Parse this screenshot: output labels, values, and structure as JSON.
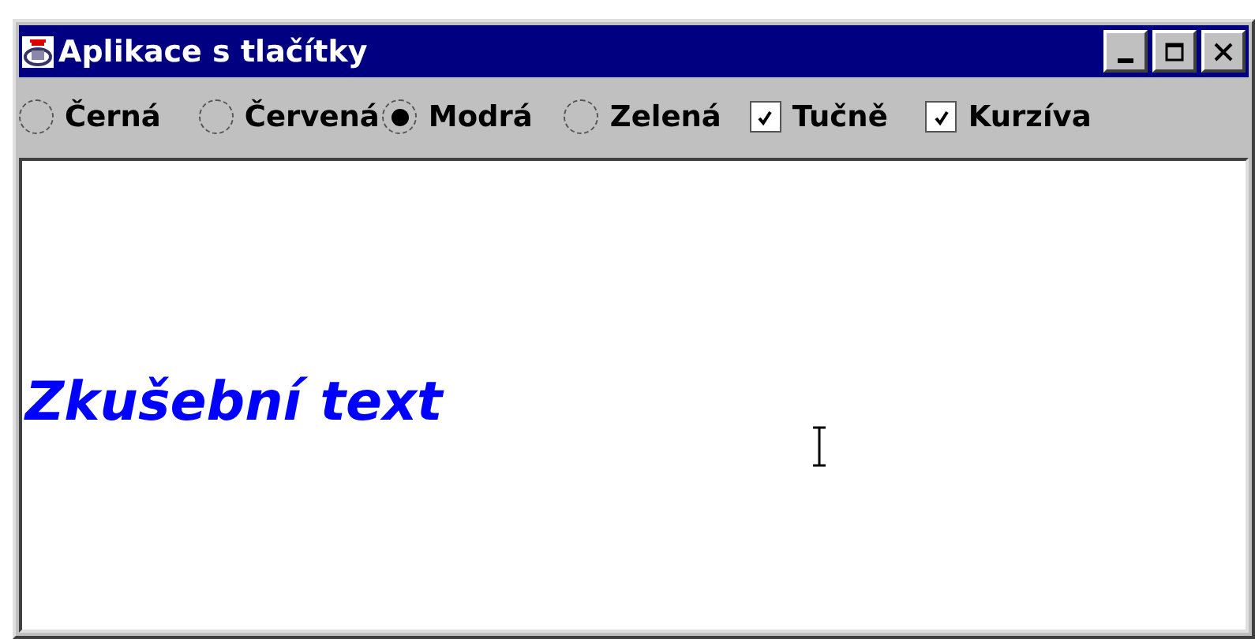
{
  "window": {
    "title": "Aplikace s tlačítky"
  },
  "options": [
    {
      "kind": "radio",
      "label": "Černá",
      "selected": false
    },
    {
      "kind": "radio",
      "label": "Červená",
      "selected": false
    },
    {
      "kind": "radio",
      "label": "Modrá",
      "selected": true
    },
    {
      "kind": "radio",
      "label": "Zelená",
      "selected": false
    },
    {
      "kind": "checkbox",
      "label": "Tučně",
      "checked": true
    },
    {
      "kind": "checkbox",
      "label": "Kurzíva",
      "checked": true
    }
  ],
  "sample_text": "Zkušební text"
}
